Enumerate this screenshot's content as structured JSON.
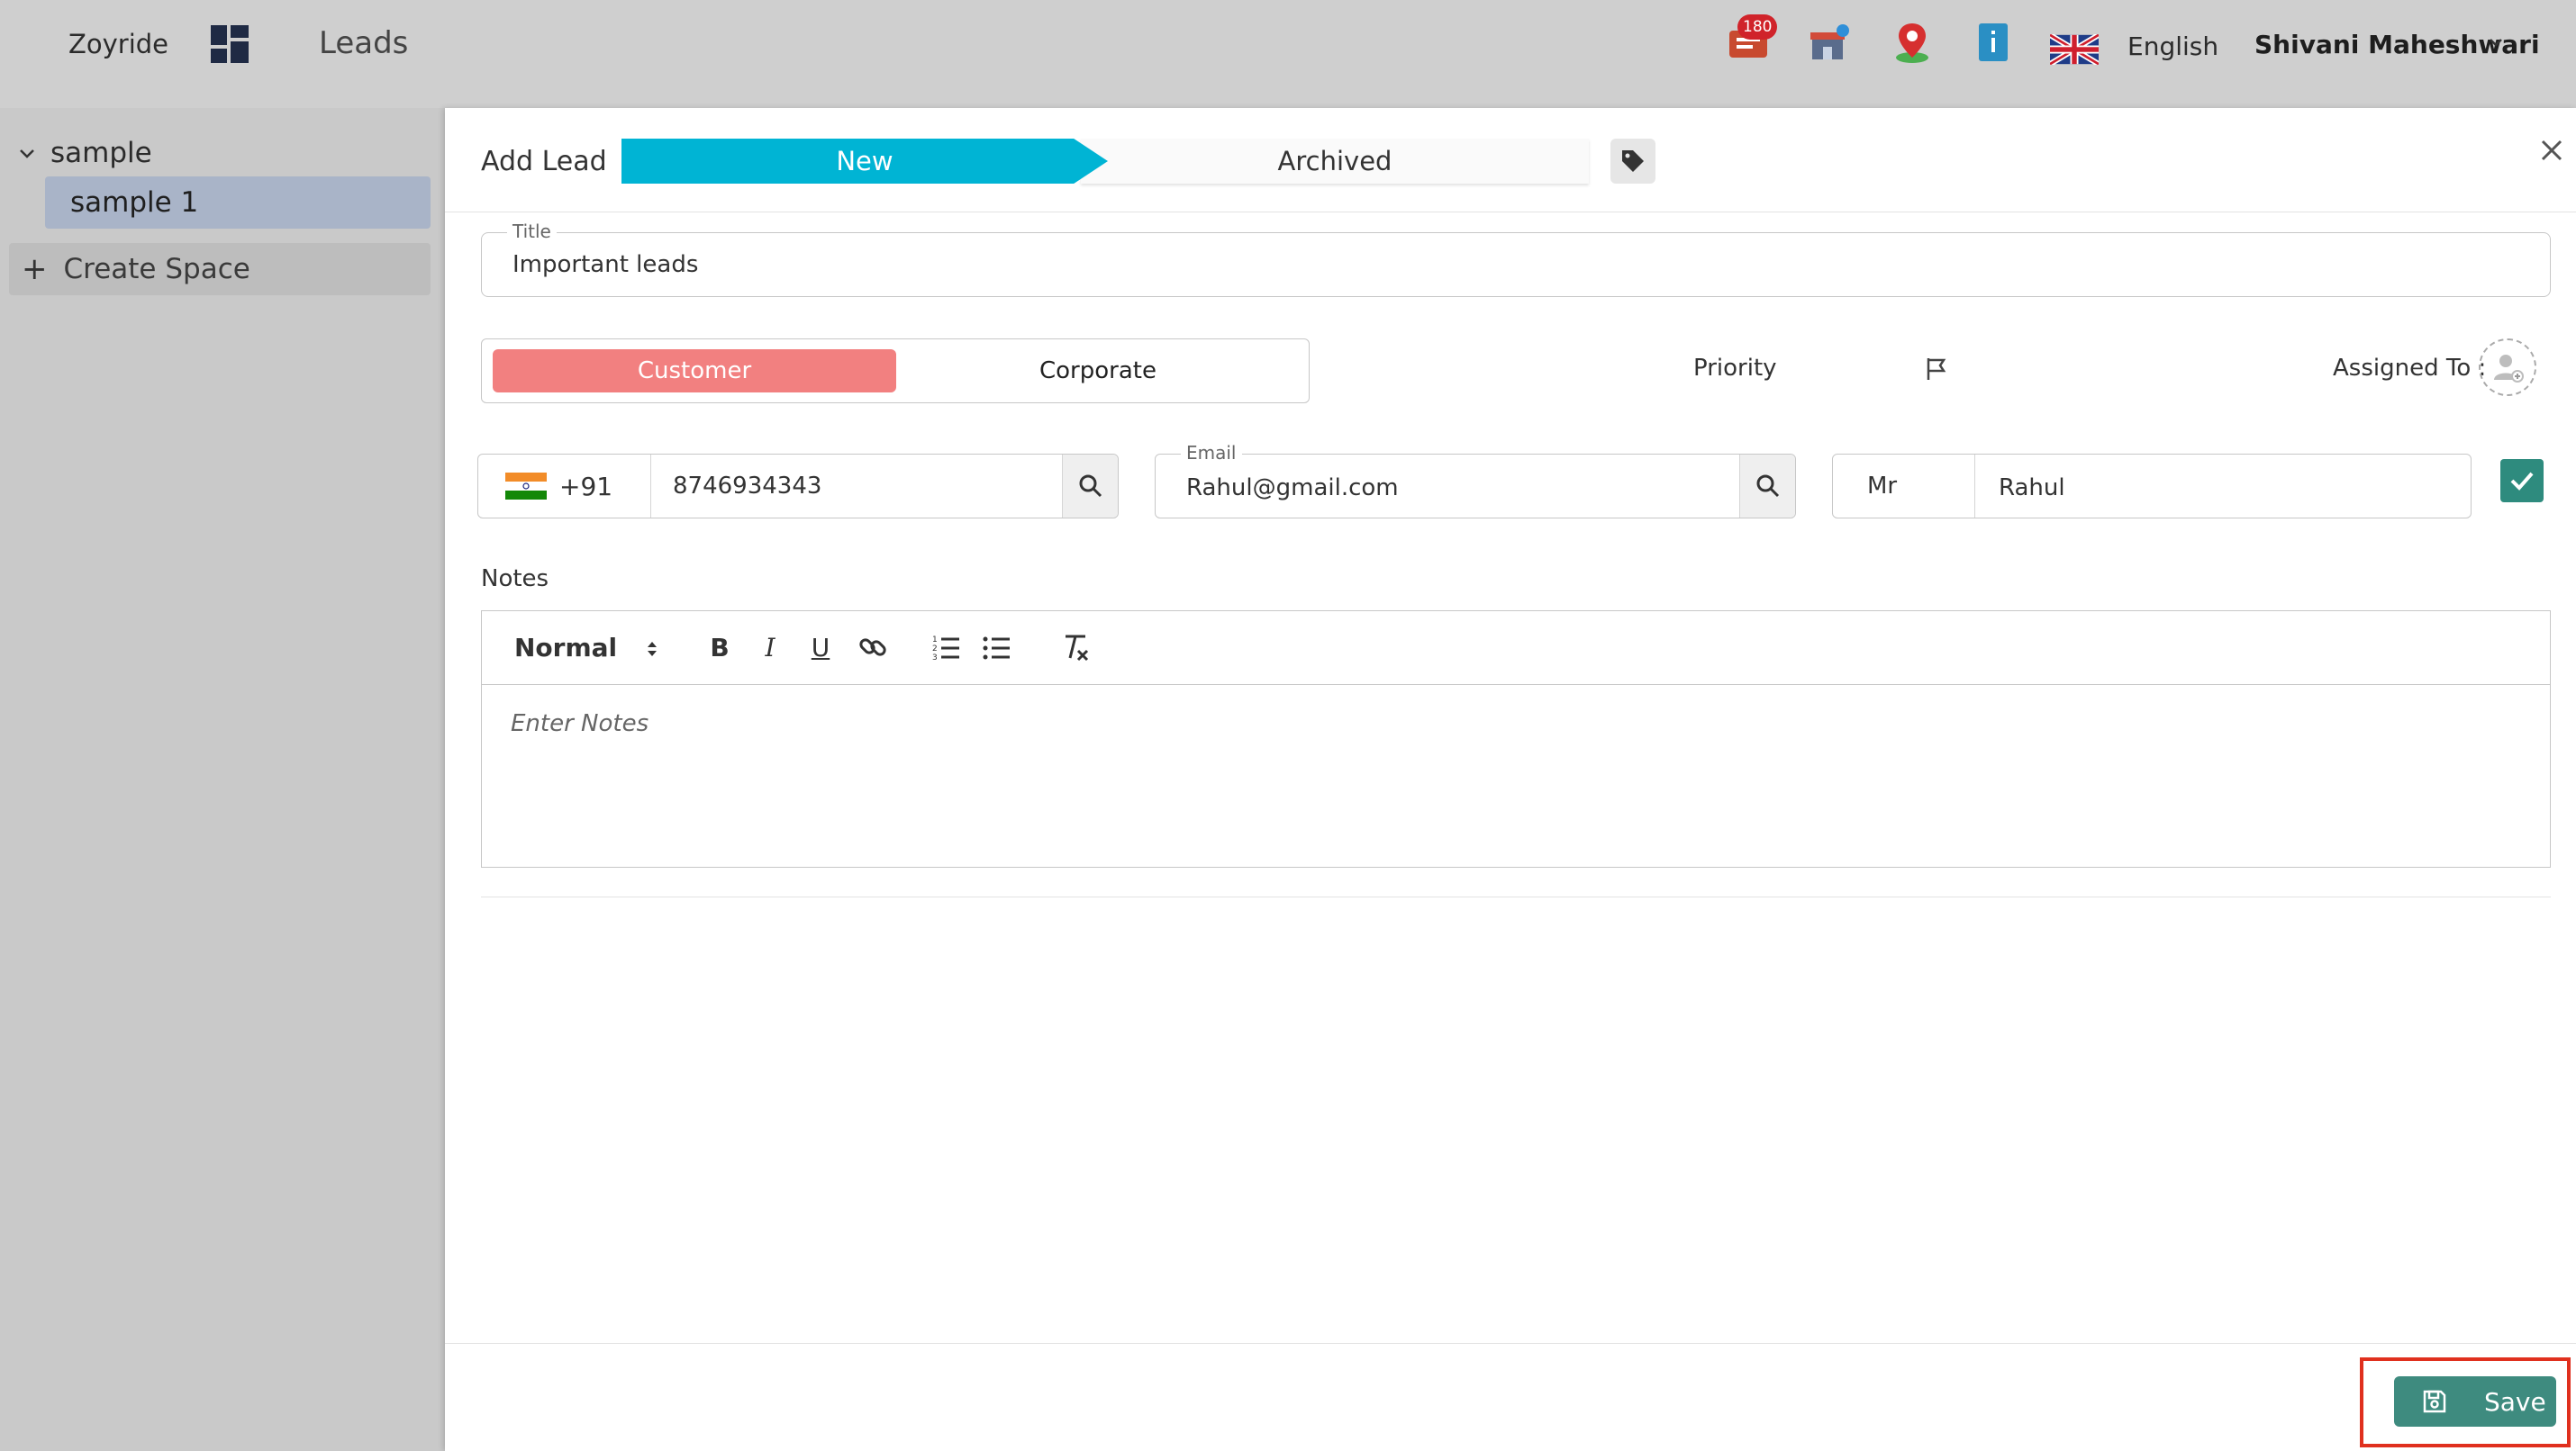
{
  "topbar": {
    "brand": "Zoyride",
    "module": "Leads",
    "notification_count": "180",
    "language": "English",
    "user_name": "Shivani Maheshwari"
  },
  "sidebar": {
    "group_label": "sample",
    "items": [
      {
        "label": "sample 1"
      }
    ],
    "create_label": "Create Space"
  },
  "form": {
    "header_title": "Add Lead",
    "stages": [
      {
        "label": "New",
        "active": true
      },
      {
        "label": "Archived",
        "active": false
      }
    ],
    "title_legend": "Title",
    "title_value": "Important leads",
    "type_options": [
      {
        "label": "Customer",
        "selected": true
      },
      {
        "label": "Corporate",
        "selected": false
      }
    ],
    "priority_label": "Priority",
    "assigned_label": "Assigned To :",
    "phone_code": "+91",
    "phone_value": "8746934343",
    "email_legend": "Email",
    "email_value": "Rahul@gmail.com",
    "salutation": "Mr",
    "name_value": "Rahul",
    "notes_label": "Notes",
    "editor_format": "Normal",
    "notes_placeholder": "Enter Notes",
    "save_label": "Save"
  },
  "colors": {
    "stage_active": "#00b4d4",
    "customer_selected": "#f28080",
    "save_button": "#3e8b7f",
    "checkbox": "#2e8b7e",
    "highlight": "#e0301e"
  },
  "icons": [
    "apps-grid-icon",
    "chat-notification-icon",
    "store-icon",
    "map-pin-icon",
    "info-book-icon",
    "uk-flag-icon",
    "chevron-down-icon",
    "close-icon",
    "tag-icon",
    "flag-icon",
    "add-user-icon",
    "india-flag-icon",
    "search-icon",
    "check-icon",
    "bold-icon",
    "italic-icon",
    "underline-icon",
    "link-icon",
    "ordered-list-icon",
    "bullet-list-icon",
    "clear-format-icon",
    "save-icon"
  ]
}
